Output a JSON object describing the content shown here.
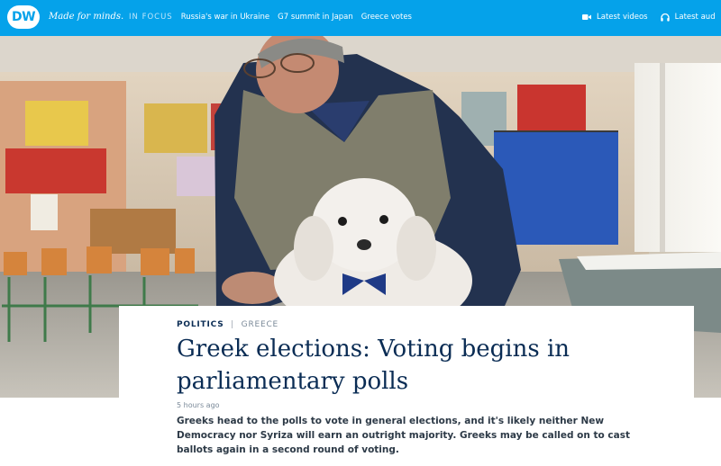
{
  "brand": {
    "logo_text": "DW",
    "tagline": "Made for minds."
  },
  "nav": {
    "in_focus_label": "IN FOCUS",
    "links": [
      "Russia's war in Ukraine",
      "G7 summit in Japan",
      "Greece votes"
    ]
  },
  "right_nav": {
    "latest_videos": "Latest videos",
    "latest_audio": "Latest aud",
    "icons": [
      "video-camera-icon",
      "headphones-icon"
    ]
  },
  "hero_image": {
    "alt": ""
  },
  "article": {
    "category": "POLITICS",
    "separator": "|",
    "tag": "GREECE",
    "headline": "Greek elections: Voting begins in parliamentary polls",
    "time_ago": "5 hours ago",
    "lead": "Greeks head to the polls to vote in general elections, and it's likely neither New Democracy nor Syriza will earn an outright majority. Greeks may be called on to cast ballots again in a second round of voting."
  },
  "colors": {
    "brand_blue": "#05a2ea",
    "headline_navy": "#0a2c54"
  }
}
